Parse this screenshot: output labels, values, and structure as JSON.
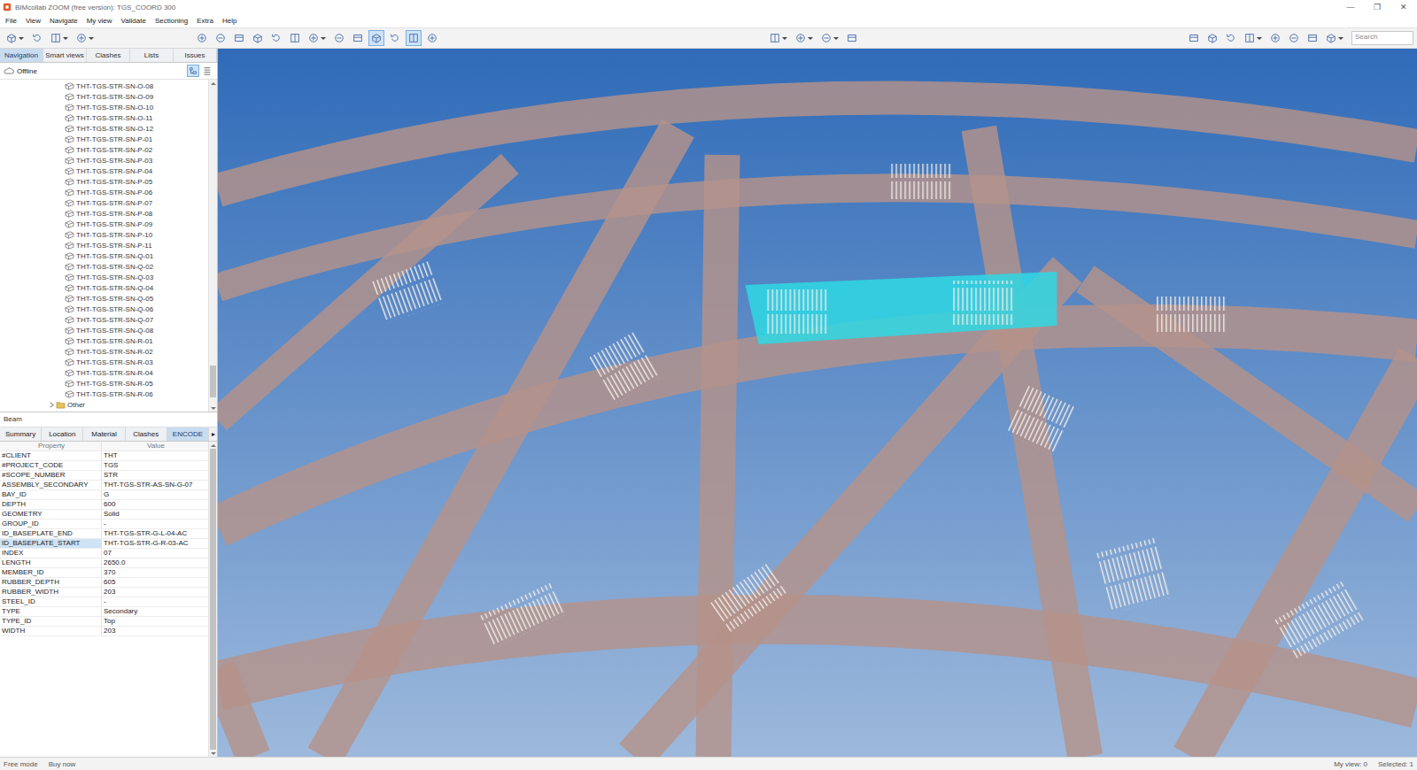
{
  "window": {
    "title": "BIMcollab ZOOM (free version): TGS_COORD 300",
    "controls": [
      "—",
      "❐",
      "✕"
    ]
  },
  "menu": [
    "File",
    "View",
    "Navigate",
    "My view",
    "Validate",
    "Sectioning",
    "Extra",
    "Help"
  ],
  "toolbar": {
    "file": [
      {
        "active": false,
        "dropdown": true
      },
      {
        "active": false,
        "dropdown": false
      },
      {
        "active": false,
        "dropdown": true
      },
      {
        "active": false,
        "dropdown": true
      }
    ],
    "view": [
      {
        "active": false,
        "dropdown": false
      },
      {
        "active": false,
        "dropdown": false
      },
      {
        "active": false,
        "dropdown": false
      },
      {
        "active": false,
        "dropdown": false
      },
      {
        "active": false,
        "dropdown": false
      },
      {
        "active": false,
        "dropdown": false
      },
      {
        "active": false,
        "dropdown": true
      },
      {
        "active": false,
        "dropdown": false
      },
      {
        "active": false,
        "dropdown": false
      },
      {
        "active": true,
        "dropdown": false
      },
      {
        "active": false,
        "dropdown": false
      },
      {
        "active": true,
        "dropdown": false
      },
      {
        "active": false,
        "dropdown": false
      }
    ],
    "center": [
      {
        "active": false,
        "dropdown": true
      },
      {
        "active": false,
        "dropdown": true
      },
      {
        "active": false,
        "dropdown": true
      },
      {
        "active": false,
        "dropdown": false
      }
    ],
    "right": [
      {
        "active": false,
        "dropdown": false
      },
      {
        "active": false,
        "dropdown": false
      },
      {
        "active": false,
        "dropdown": false
      },
      {
        "active": false,
        "dropdown": true
      },
      {
        "active": false,
        "dropdown": false
      },
      {
        "active": false,
        "dropdown": false
      },
      {
        "active": false,
        "dropdown": false
      },
      {
        "active": false,
        "dropdown": true
      }
    ],
    "search": {
      "placeholder": "Search"
    }
  },
  "panel_tabs": [
    {
      "label": "Navigation",
      "selected": true
    },
    {
      "label": "Smart views",
      "selected": false
    },
    {
      "label": "Clashes",
      "selected": false
    },
    {
      "label": "Lists",
      "selected": false
    },
    {
      "label": "Issues",
      "selected": false
    }
  ],
  "connection": {
    "label": "Offline"
  },
  "panel_tools": [
    {
      "active": true
    },
    {
      "active": false
    }
  ],
  "tree": {
    "items": [
      {
        "label": "THT-TGS-STR-SN-O-08",
        "kind": "item"
      },
      {
        "label": "THT-TGS-STR-SN-O-09",
        "kind": "item"
      },
      {
        "label": "THT-TGS-STR-SN-O-10",
        "kind": "item"
      },
      {
        "label": "THT-TGS-STR-SN-O-11",
        "kind": "item"
      },
      {
        "label": "THT-TGS-STR-SN-O-12",
        "kind": "item"
      },
      {
        "label": "THT-TGS-STR-SN-P-01",
        "kind": "item"
      },
      {
        "label": "THT-TGS-STR-SN-P-02",
        "kind": "item"
      },
      {
        "label": "THT-TGS-STR-SN-P-03",
        "kind": "item"
      },
      {
        "label": "THT-TGS-STR-SN-P-04",
        "kind": "item"
      },
      {
        "label": "THT-TGS-STR-SN-P-05",
        "kind": "item"
      },
      {
        "label": "THT-TGS-STR-SN-P-06",
        "kind": "item"
      },
      {
        "label": "THT-TGS-STR-SN-P-07",
        "kind": "item"
      },
      {
        "label": "THT-TGS-STR-SN-P-08",
        "kind": "item"
      },
      {
        "label": "THT-TGS-STR-SN-P-09",
        "kind": "item"
      },
      {
        "label": "THT-TGS-STR-SN-P-10",
        "kind": "item"
      },
      {
        "label": "THT-TGS-STR-SN-P-11",
        "kind": "item"
      },
      {
        "label": "THT-TGS-STR-SN-Q-01",
        "kind": "item"
      },
      {
        "label": "THT-TGS-STR-SN-Q-02",
        "kind": "item"
      },
      {
        "label": "THT-TGS-STR-SN-Q-03",
        "kind": "item"
      },
      {
        "label": "THT-TGS-STR-SN-Q-04",
        "kind": "item"
      },
      {
        "label": "THT-TGS-STR-SN-Q-05",
        "kind": "item"
      },
      {
        "label": "THT-TGS-STR-SN-Q-06",
        "kind": "item"
      },
      {
        "label": "THT-TGS-STR-SN-Q-07",
        "kind": "item"
      },
      {
        "label": "THT-TGS-STR-SN-Q-08",
        "kind": "item"
      },
      {
        "label": "THT-TGS-STR-SN-R-01",
        "kind": "item"
      },
      {
        "label": "THT-TGS-STR-SN-R-02",
        "kind": "item"
      },
      {
        "label": "THT-TGS-STR-SN-R-03",
        "kind": "item"
      },
      {
        "label": "THT-TGS-STR-SN-R-04",
        "kind": "item"
      },
      {
        "label": "THT-TGS-STR-SN-R-05",
        "kind": "item"
      },
      {
        "label": "THT-TGS-STR-SN-R-06",
        "kind": "item"
      },
      {
        "label": "Other",
        "kind": "folder",
        "expanded": false
      }
    ]
  },
  "properties": {
    "title": "Beam",
    "tabs": [
      {
        "label": "Summary",
        "selected": false
      },
      {
        "label": "Location",
        "selected": false
      },
      {
        "label": "Material",
        "selected": false
      },
      {
        "label": "Clashes",
        "selected": false
      },
      {
        "label": "ENCODE",
        "selected": true
      }
    ],
    "more": "▸",
    "columns": [
      "Property",
      "Value"
    ],
    "rows": [
      {
        "property": "#CLIENT",
        "value": "THT",
        "selected": false
      },
      {
        "property": "#PROJECT_CODE",
        "value": "TGS",
        "selected": false
      },
      {
        "property": "#SCOPE_NUMBER",
        "value": "STR",
        "selected": false
      },
      {
        "property": "ASSEMBLY_SECONDARY",
        "value": "THT-TGS-STR-AS-SN-G-07",
        "selected": false
      },
      {
        "property": "BAY_ID",
        "value": "G",
        "selected": false
      },
      {
        "property": "DEPTH",
        "value": "600",
        "selected": false
      },
      {
        "property": "GEOMETRY",
        "value": "Solid",
        "selected": false
      },
      {
        "property": "GROUP_ID",
        "value": "-",
        "selected": false
      },
      {
        "property": "ID_BASEPLATE_END",
        "value": "THT-TGS-STR-G-L-04-AC",
        "selected": false
      },
      {
        "property": "ID_BASEPLATE_START",
        "value": "THT-TGS-STR-G-R-03-AC",
        "selected": true
      },
      {
        "property": "INDEX",
        "value": "07",
        "selected": false
      },
      {
        "property": "LENGTH",
        "value": "2650.0",
        "selected": false
      },
      {
        "property": "MEMBER_ID",
        "value": "370",
        "selected": false
      },
      {
        "property": "RUBBER_DEPTH",
        "value": "605",
        "selected": false
      },
      {
        "property": "RUBBER_WIDTH",
        "value": "203",
        "selected": false
      },
      {
        "property": "STEEL_ID",
        "value": "-",
        "selected": false
      },
      {
        "property": "TYPE",
        "value": "Secondary",
        "selected": false
      },
      {
        "property": "TYPE_ID",
        "value": "Top",
        "selected": false
      },
      {
        "property": "WIDTH",
        "value": "203",
        "selected": false
      }
    ]
  },
  "status_bar": {
    "left": [
      "Free mode",
      "Buy now"
    ],
    "right": [
      "My view: 0",
      "Selected: 1"
    ]
  }
}
